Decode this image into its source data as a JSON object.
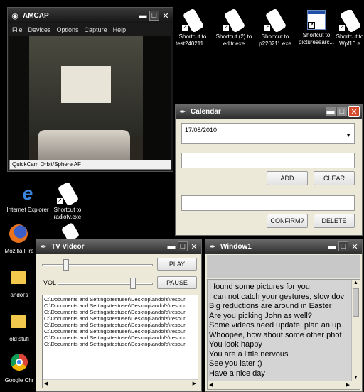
{
  "amcap": {
    "title": "AMCAP",
    "menu": [
      "File",
      "Devices",
      "Options",
      "Capture",
      "Help"
    ],
    "status": "QuickCam Orbit/Sphere AF"
  },
  "desktop_icons_top": [
    {
      "label": "Shortcut to test240211...."
    },
    {
      "label": "Shortcut (2) to editr.exe"
    },
    {
      "label": "Shortcut to p220211.exe"
    },
    {
      "label": "Shortcut to picturesearc..."
    },
    {
      "label": "Shortcut to Wpf10.e"
    }
  ],
  "desktop_icons_left": [
    {
      "label": "Internet Explorer",
      "icon": "internet-explorer-icon"
    },
    {
      "label": "Shortcut to radiotv.exe",
      "icon": "shortcut-icon"
    },
    {
      "label": "Mozilla Fire",
      "icon": "firefox-icon"
    },
    {
      "label": "andol's",
      "icon": "folder-icon"
    },
    {
      "label": "old stufi",
      "icon": "folder-icon"
    },
    {
      "label": "Google Chr",
      "icon": "chrome-icon"
    }
  ],
  "calendar": {
    "title": "Calendar",
    "date_value": "17/08/2010",
    "add_label": "ADD",
    "clear_label": "CLEAR",
    "confirm_label": "CONFIRM?",
    "delete_label": "DELETE"
  },
  "tv_videor": {
    "title": "TV Videor",
    "play_label": "PLAY",
    "vol_label": "VOL",
    "pause_label": "PAUSE",
    "files": [
      "C:\\Documents and Settings\\testuser\\Desktop\\andol's\\resour",
      "C:\\Documents and Settings\\testuser\\Desktop\\andol's\\resour",
      "C:\\Documents and Settings\\testuser\\Desktop\\andol's\\resour",
      "C:\\Documents and Settings\\testuser\\Desktop\\andol's\\resour",
      "C:\\Documents and Settings\\testuser\\Desktop\\andol's\\resour",
      "C:\\Documents and Settings\\testuser\\Desktop\\andol's\\resour",
      "C:\\Documents and Settings\\testuser\\Desktop\\andol's\\resour",
      "C:\\Documents and Settings\\testuser\\Desktop\\andol's\\resour"
    ]
  },
  "window1": {
    "title": "Window1",
    "messages": [
      "I found some pictures for you",
      "I can not catch your gestures, slow dov",
      "Big reductions are around in Easter",
      "Are you picking John as well?",
      "Some videos need update, plan an up",
      "Whoopee, how about some other phot",
      "You look happy",
      "You are a little nervous",
      "See you later ;)",
      "Have a nice day"
    ]
  },
  "colors": {
    "desktop": "#000000",
    "titlebar": "#2e2e2e",
    "window_bg": "#ece9d8",
    "close_red": "#d34a2c"
  }
}
